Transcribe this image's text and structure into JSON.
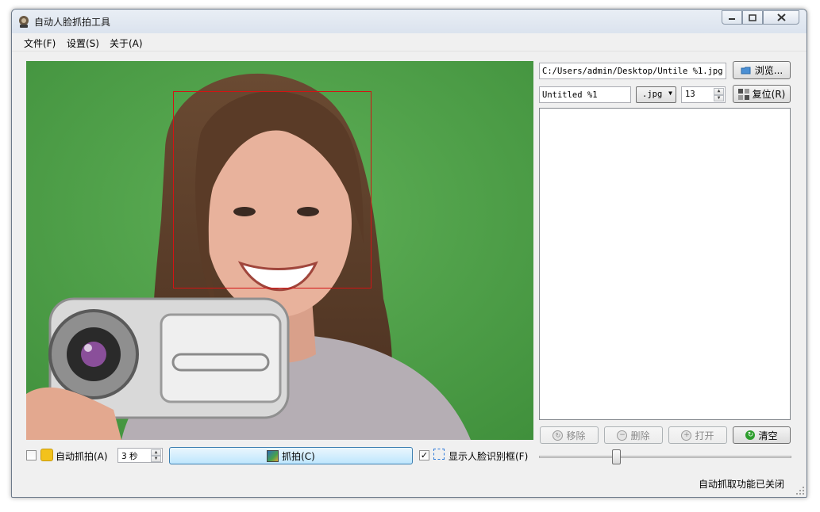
{
  "window": {
    "title": "自动人脸抓拍工具",
    "close_glyph": "✕",
    "min_glyph": "▁",
    "max_glyph": "□"
  },
  "menu": {
    "file": "文件(F)",
    "settings": "设置(S)",
    "about": "关于(A)"
  },
  "preview": {
    "face_detected": true
  },
  "right_panel": {
    "path_value": "C:/Users/admin/Desktop/Untile %1.jpg",
    "browse_label": "浏览...",
    "filename_value": "Untitled %1",
    "format_value": ".jpg",
    "quality_value": "13",
    "reset_label": "复位(R)",
    "captures": [],
    "remove_label": "移除",
    "delete_label": "删除",
    "open_label": "打开",
    "clear_label": "清空",
    "slider_value": 0.3
  },
  "bottom_bar": {
    "auto_capture_checked": false,
    "auto_capture_label": "自动抓拍(A)",
    "interval_value": "3 秒",
    "capture_label": "抓拍(C)",
    "show_face_frame_checked": true,
    "show_face_frame_label": "显示人脸识别框(F)",
    "check_glyph": "✓"
  },
  "status": {
    "text": "自动抓取功能已关闭"
  },
  "colors": {
    "face_box": "#d21414",
    "green_screen": "#52a34a",
    "clear_icon": "#2e9e2e"
  }
}
